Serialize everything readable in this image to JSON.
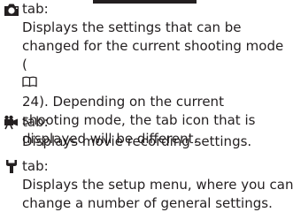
{
  "sections": [
    {
      "icon": "camera-icon",
      "label": "tab:",
      "description_lines": [
        "Displays the settings that can be",
        "changed for the current shooting mode",
        "24). Depending on the current",
        "shooting mode, the tab icon that is",
        "displayed will be different."
      ],
      "ref_prefix": "("
    },
    {
      "icon": "movie-camera-icon",
      "label": "tab:",
      "description_lines": [
        "Displays movie recording settings."
      ]
    },
    {
      "icon": "wrench-icon",
      "label": "tab:",
      "description_lines": [
        "Displays the setup menu, where you can",
        "change a number of general settings."
      ]
    }
  ],
  "colors": {
    "text": "#231f20"
  }
}
